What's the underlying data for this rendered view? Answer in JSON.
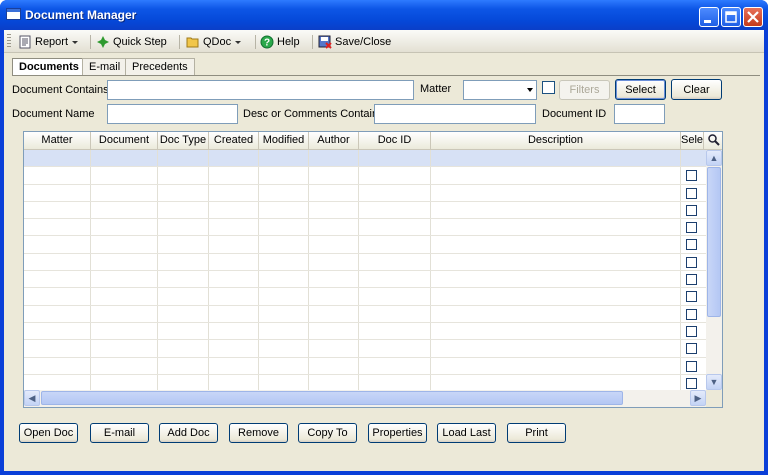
{
  "window": {
    "title": "Document Manager"
  },
  "toolbar": {
    "report": "Report",
    "quick_step": "Quick Step",
    "qdoc": "QDoc",
    "help": "Help",
    "save_close": "Save/Close"
  },
  "tabs": [
    "Documents",
    "E-mail",
    "Precedents"
  ],
  "search": {
    "document_contains_label": "Document Contains",
    "document_contains_value": "",
    "matter_label": "Matter",
    "matter_value": "",
    "filters_label": "Filters",
    "select_label": "Select",
    "clear_label": "Clear",
    "document_name_label": "Document Name",
    "document_name_value": "",
    "desc_label": "Desc or Comments Contain",
    "desc_value": "",
    "document_id_label": "Document ID",
    "document_id_value": ""
  },
  "grid": {
    "columns": [
      "Matter",
      "Document",
      "Doc Type",
      "Created",
      "Modified",
      "Author",
      "Doc ID",
      "Description",
      "Selec"
    ],
    "row_count": 14,
    "selected_row": 0
  },
  "buttons": {
    "open_doc": "Open Doc",
    "email": "E-mail",
    "add_doc": "Add Doc",
    "remove": "Remove",
    "copy_to": "Copy To",
    "properties": "Properties",
    "load_last": "Load Last",
    "print": "Print"
  },
  "colors": {
    "titlebar": "#0548d8",
    "face": "#ece9d8",
    "selected_row": "#d7e1f5"
  }
}
